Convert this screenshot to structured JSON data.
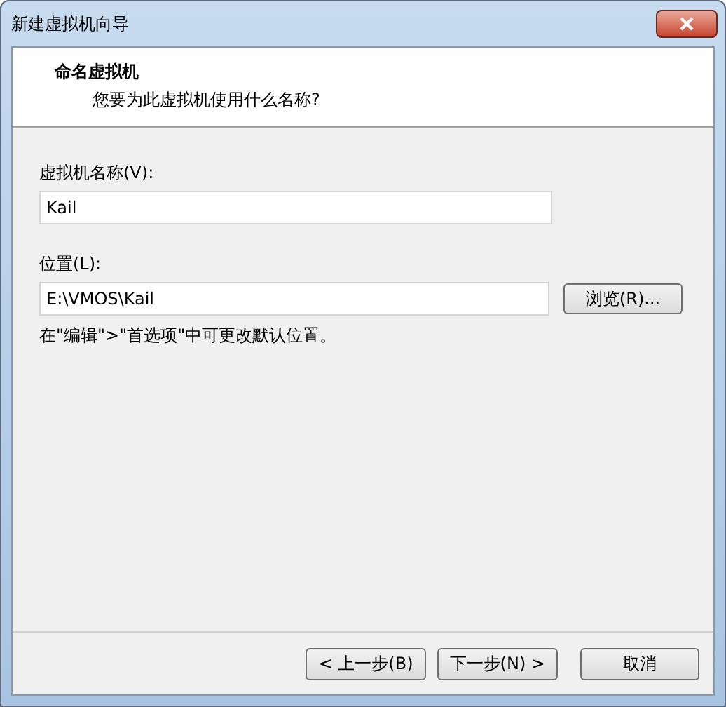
{
  "window": {
    "title": "新建虚拟机向导"
  },
  "header": {
    "title": "命名虚拟机",
    "subtitle": "您要为此虚拟机使用什么名称?"
  },
  "name_field": {
    "label": "虚拟机名称(V):",
    "value": "Kail"
  },
  "location_field": {
    "label": "位置(L):",
    "value": "E:\\VMOS\\Kail",
    "browse": "浏览(R)..."
  },
  "hint": "在\"编辑\">\"首选项\"中可更改默认位置。",
  "buttons": [
    "< 上一步(B)",
    "下一步(N) >",
    "取消"
  ]
}
